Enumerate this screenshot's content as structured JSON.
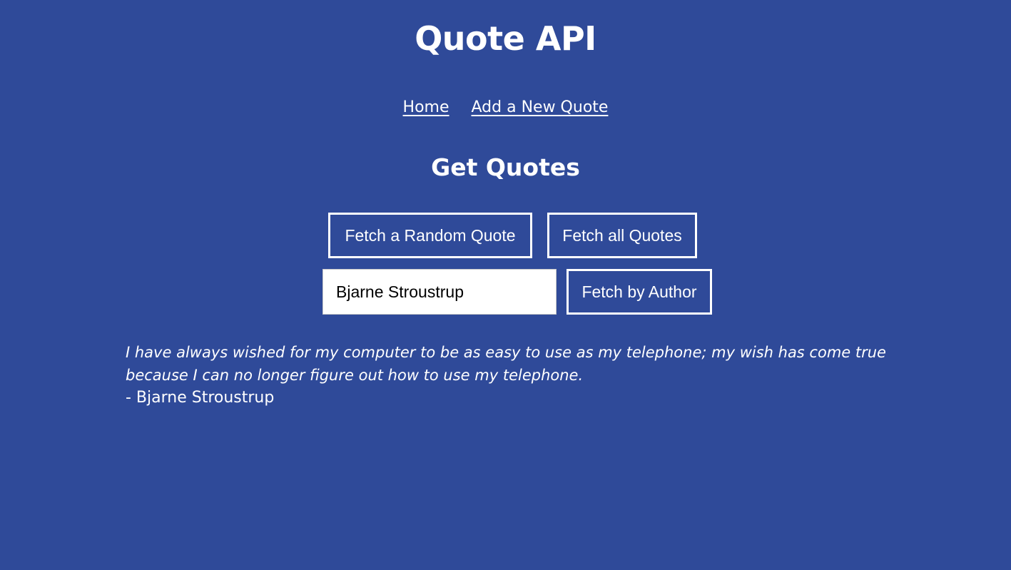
{
  "header": {
    "title": "Quote API"
  },
  "nav": {
    "items": [
      {
        "label": "Home"
      },
      {
        "label": "Add a New Quote"
      }
    ]
  },
  "main": {
    "section_title": "Get Quotes",
    "buttons": {
      "random_label": "Fetch a Random Quote",
      "all_label": "Fetch all Quotes",
      "author_label": "Fetch by Author"
    },
    "author_input": {
      "value": "Bjarne Stroustrup",
      "placeholder": ""
    },
    "quote": {
      "text": "I have always wished for my computer to be as easy to use as my telephone; my wish has come true because I can no longer figure out how to use my telephone.",
      "author": "- Bjarne Stroustrup"
    }
  },
  "colors": {
    "background": "#2f4a99",
    "text": "#ffffff",
    "input_background": "#ffffff"
  }
}
